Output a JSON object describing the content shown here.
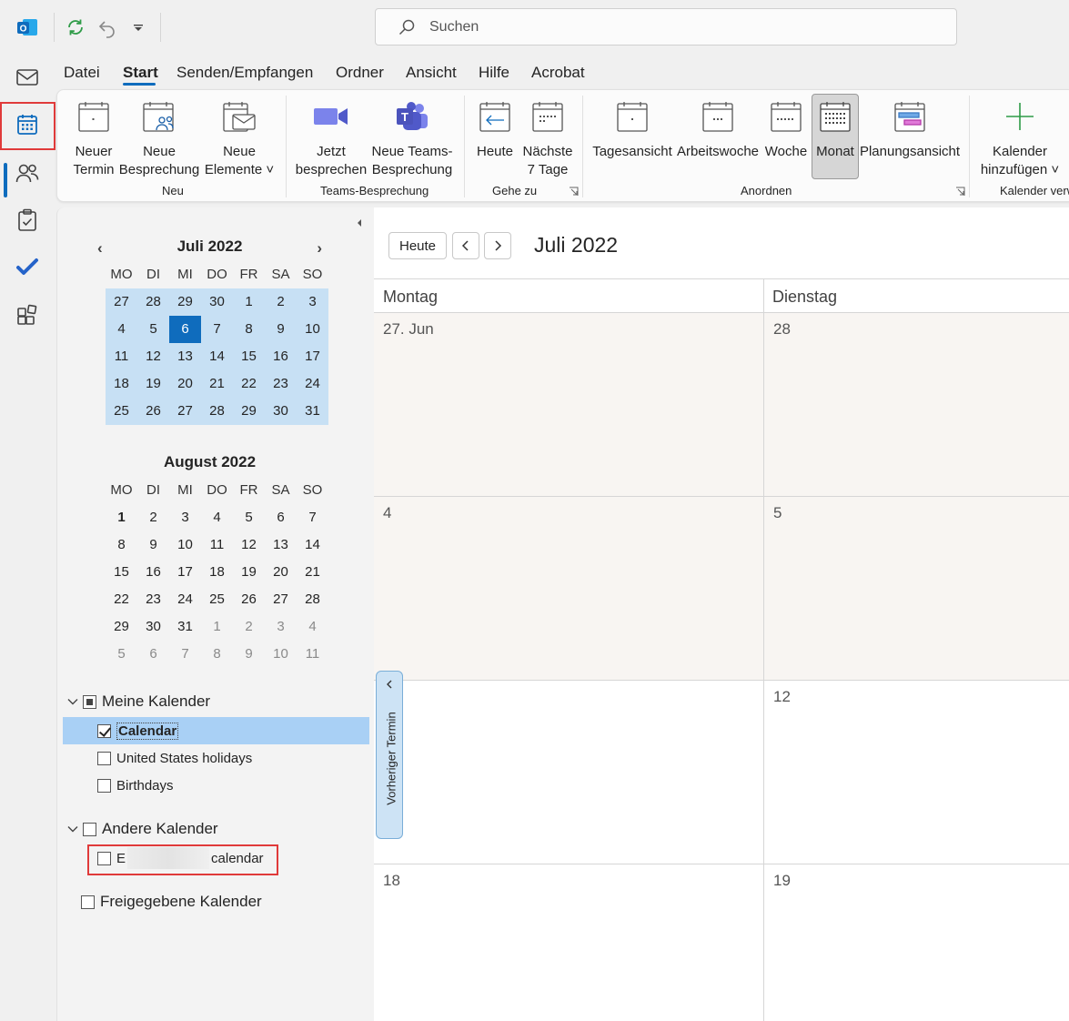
{
  "titlebar": {
    "app_icon": "outlook-icon",
    "quick_access": [
      "sync-icon",
      "undo-icon",
      "customize-qat-icon"
    ],
    "search": {
      "placeholder": "Suchen",
      "icon": "search-icon"
    }
  },
  "leftnav": {
    "items": [
      "mail-icon",
      "calendar-icon",
      "people-icon",
      "tasks-icon",
      "todo-icon",
      "apps-icon"
    ],
    "active": "calendar-icon"
  },
  "menu_tabs": [
    "Datei",
    "Start",
    "Senden/Empfangen",
    "Ordner",
    "Ansicht",
    "Hilfe",
    "Acrobat"
  ],
  "active_tab": "Start",
  "ribbon": {
    "neuer_termin": "Neuer\nTermin",
    "neue_besprechung": "Neue\nBesprechung",
    "neue_elemente": "Neue\nElemente ˅",
    "group_neu": "Neu",
    "jetzt_besprechen": "Jetzt\nbesprechen",
    "neue_teams": "Neue Teams-\nBesprechung",
    "group_teams": "Teams-Besprechung",
    "heute": "Heute",
    "naechste_7": "Nächste\n7 Tage",
    "group_gehe_zu": "Gehe zu",
    "tagesansicht": "Tagesansicht",
    "arbeitswoche": "Arbeitswoche",
    "woche": "Woche",
    "monat": "Monat",
    "planungsansicht": "Planungsansicht",
    "group_anordnen": "Anordnen",
    "kalender_hinzufuegen": "Kalender\nhinzufügen ˅",
    "group_kalender_verw": "Kalender verw"
  },
  "minical": {
    "dow": [
      "MO",
      "DI",
      "MI",
      "DO",
      "FR",
      "SA",
      "SO"
    ],
    "july": {
      "title": "Juli 2022",
      "weeks": [
        [
          "27",
          "28",
          "29",
          "30",
          "1",
          "2",
          "3"
        ],
        [
          "4",
          "5",
          "6",
          "7",
          "8",
          "9",
          "10"
        ],
        [
          "11",
          "12",
          "13",
          "14",
          "15",
          "16",
          "17"
        ],
        [
          "18",
          "19",
          "20",
          "21",
          "22",
          "23",
          "24"
        ],
        [
          "25",
          "26",
          "27",
          "28",
          "29",
          "30",
          "31"
        ]
      ],
      "today": "6"
    },
    "august": {
      "title": "August 2022",
      "weeks": [
        [
          "1",
          "2",
          "3",
          "4",
          "5",
          "6",
          "7"
        ],
        [
          "8",
          "9",
          "10",
          "11",
          "12",
          "13",
          "14"
        ],
        [
          "15",
          "16",
          "17",
          "18",
          "19",
          "20",
          "21"
        ],
        [
          "22",
          "23",
          "24",
          "25",
          "26",
          "27",
          "28"
        ],
        [
          "29",
          "30",
          "31",
          "1",
          "2",
          "3",
          "4"
        ],
        [
          "5",
          "6",
          "7",
          "8",
          "9",
          "10",
          "11"
        ]
      ]
    }
  },
  "folders": {
    "meine_kalender": "Meine Kalender",
    "calendar": "Calendar",
    "us_holidays": "United States holidays",
    "birthdays": "Birthdays",
    "andere_kalender": "Andere Kalender",
    "ext_prefix": "E",
    "ext_suffix": "calendar",
    "freigegebene": "Freigegebene Kalender"
  },
  "main": {
    "heute_btn": "Heute",
    "title": "Juli 2022",
    "columns": [
      "Montag",
      "Dienstag"
    ],
    "rows": [
      [
        "27. Jun",
        "28"
      ],
      [
        "4",
        "5"
      ],
      [
        "",
        "12"
      ],
      [
        "18",
        "19"
      ]
    ],
    "prev_appt": "Vorheriger Termin"
  },
  "colors": {
    "accent": "#0f6cbd",
    "highlight_box": "#e03a3a",
    "selection": "#a9d0f5"
  }
}
